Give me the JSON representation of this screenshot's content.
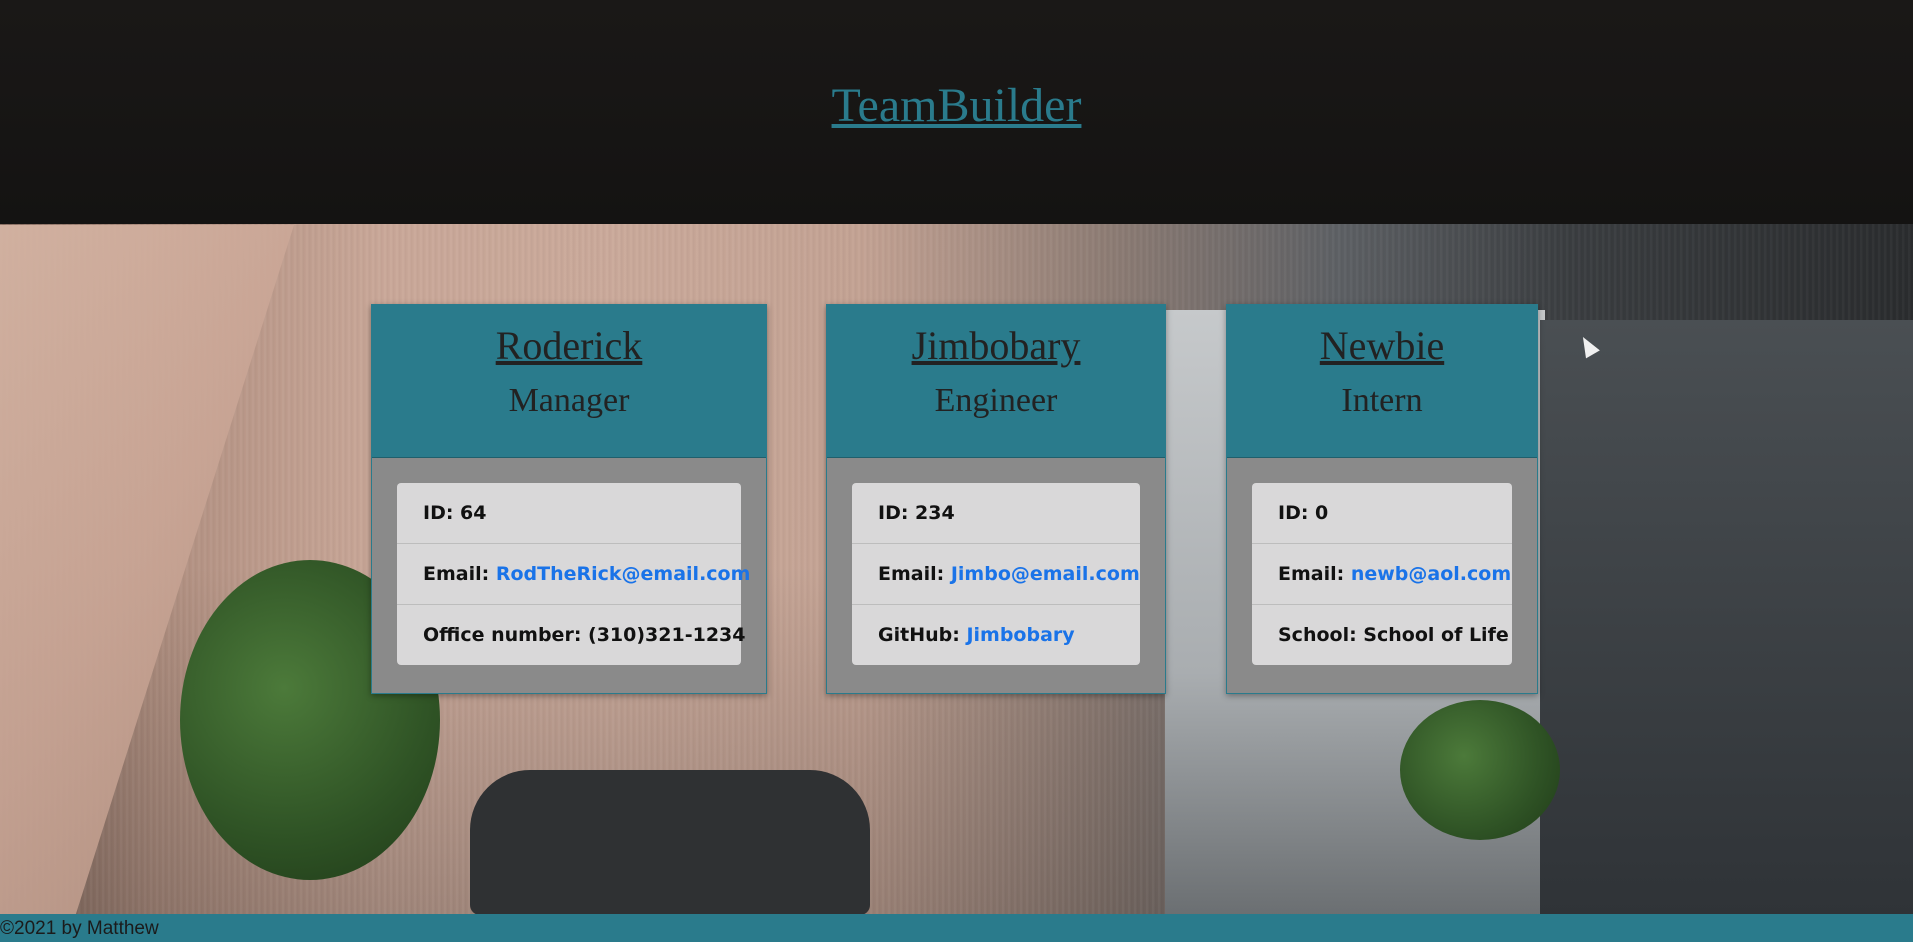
{
  "header": {
    "title": "TeamBuilder"
  },
  "cards": [
    {
      "name": "Roderick",
      "role": "Manager",
      "id_label": "ID: 64",
      "email_label": "Email: ",
      "email": "RodTheRick@email.com",
      "extra_label": "Office number: (310)321-1234"
    },
    {
      "name": "Jimbobary",
      "role": "Engineer",
      "id_label": "ID: 234",
      "email_label": "Email: ",
      "email": "Jimbo@email.com",
      "extra_label": "GitHub: ",
      "extra_link": "Jimbobary"
    },
    {
      "name": "Newbie",
      "role": "Intern",
      "id_label": "ID: 0",
      "email_label": "Email: ",
      "email": "newb@aol.com",
      "extra_label": "School: School of Life"
    }
  ],
  "footer": {
    "text": "©2021 by Matthew"
  },
  "colors": {
    "accent": "#2a7b8c",
    "card_body": "#8a8a8a",
    "info_bg": "#d9d8d9",
    "link": "#1a73e8",
    "header_bg": "#141312"
  }
}
